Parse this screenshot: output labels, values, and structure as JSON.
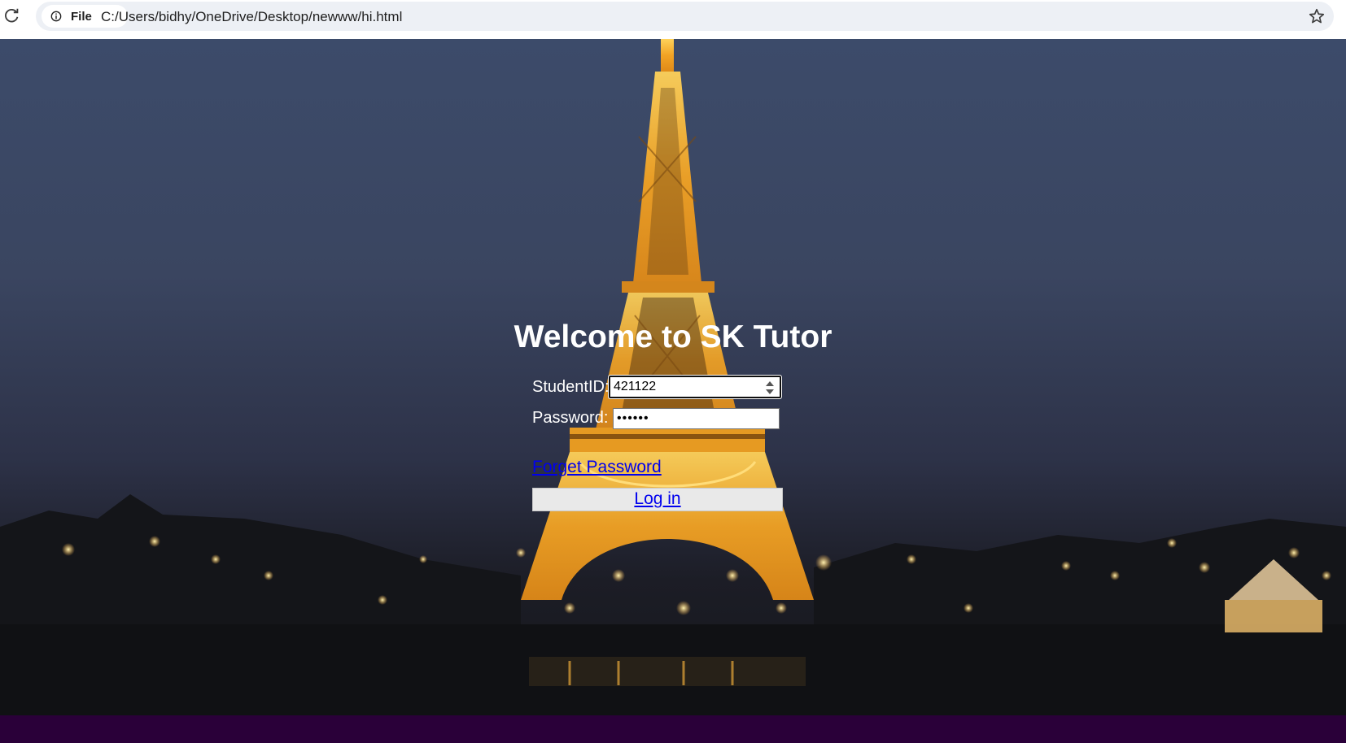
{
  "browser": {
    "chip_label": "File",
    "url": "C:/Users/bidhy/OneDrive/Desktop/newww/hi.html"
  },
  "page": {
    "title": "Welcome to SK Tutor",
    "student_id_label": "StudentID:",
    "student_id_value": "421122",
    "password_label": "Password:",
    "password_value": "••••••",
    "forgot_link": "Forget Password",
    "login_button": "Log in"
  },
  "colors": {
    "link": "#0000ee",
    "bottom_bar": "#2a0039"
  },
  "icons": [
    "reload-icon",
    "info-icon",
    "star-icon",
    "spinner-arrows-icon"
  ]
}
